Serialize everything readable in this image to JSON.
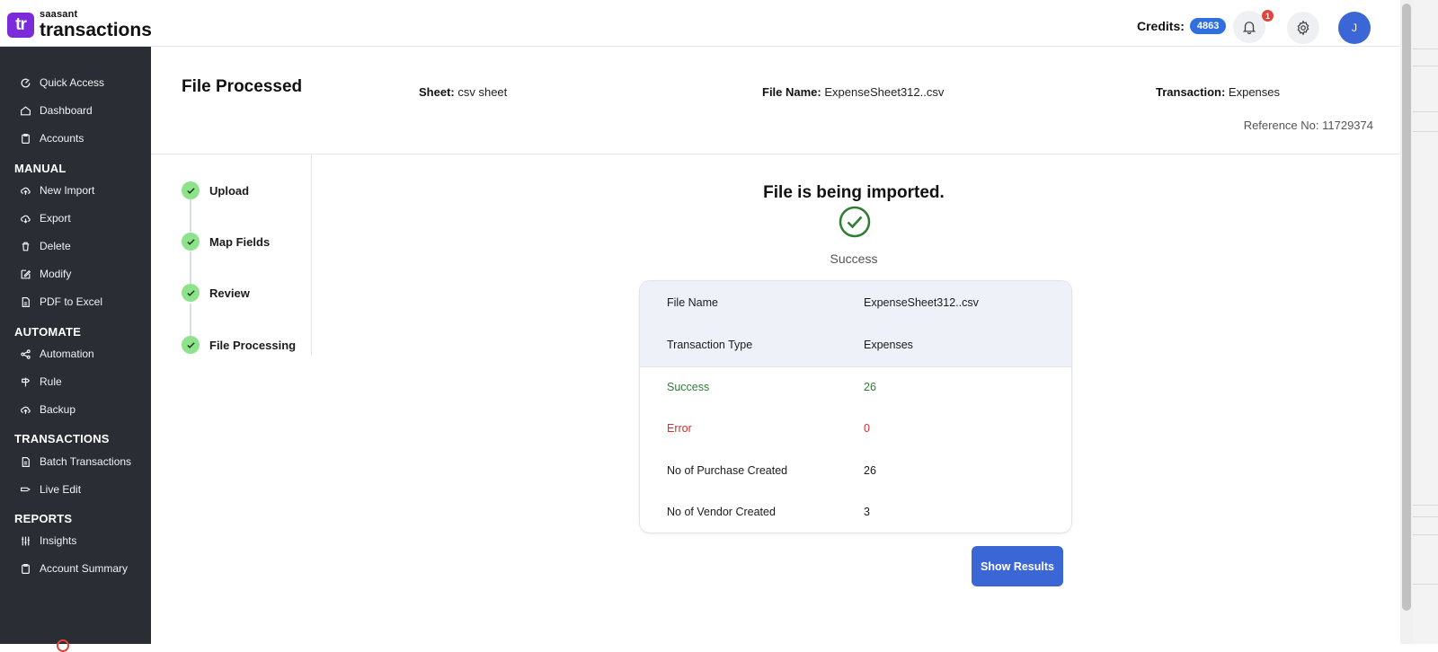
{
  "brand": {
    "small": "saasant",
    "big": "transactions",
    "badge": "tr",
    "color": "#7b2bd9"
  },
  "header": {
    "credits_label": "Credits:",
    "credits_value": "4863",
    "notification_count": "1",
    "avatar_initial": "J"
  },
  "sidebar": {
    "items_top": [
      {
        "label": "Quick Access",
        "icon": "quick-access-icon"
      },
      {
        "label": "Dashboard",
        "icon": "home-icon"
      },
      {
        "label": "Accounts",
        "icon": "clipboard-icon"
      }
    ],
    "sections": [
      {
        "title": "MANUAL",
        "items": [
          {
            "label": "New Import",
            "icon": "upload-cloud-icon"
          },
          {
            "label": "Export",
            "icon": "download-cloud-icon"
          },
          {
            "label": "Delete",
            "icon": "trash-icon"
          },
          {
            "label": "Modify",
            "icon": "edit-icon"
          },
          {
            "label": "PDF to Excel",
            "icon": "pdf-icon"
          }
        ]
      },
      {
        "title": "AUTOMATE",
        "items": [
          {
            "label": "Automation",
            "icon": "share-icon"
          },
          {
            "label": "Rule",
            "icon": "signpost-icon"
          },
          {
            "label": "Backup",
            "icon": "backup-icon"
          }
        ]
      },
      {
        "title": "TRANSACTIONS",
        "items": [
          {
            "label": "Batch Transactions",
            "icon": "document-icon"
          },
          {
            "label": "Live Edit",
            "icon": "pen-icon"
          }
        ]
      },
      {
        "title": "REPORTS",
        "items": [
          {
            "label": "Insights",
            "icon": "sliders-icon"
          },
          {
            "label": "Account Summary",
            "icon": "clipboard-icon"
          }
        ]
      }
    ]
  },
  "page": {
    "title": "File Processed",
    "sheet_label": "Sheet:",
    "sheet_value": "csv sheet",
    "file_label": "File Name:",
    "file_value": "ExpenseSheet312..csv",
    "transaction_label": "Transaction:",
    "transaction_value": "Expenses",
    "reference": "Reference No: 11729374"
  },
  "steps": [
    "Upload",
    "Map Fields",
    "Review",
    "File Processing"
  ],
  "status": {
    "title": "File is being imported.",
    "text": "Success",
    "success_color": "#2e7d32",
    "error_color": "#d32f2f"
  },
  "summary": {
    "rows": [
      {
        "key": "File Name",
        "value": "ExpenseSheet312..csv"
      },
      {
        "key": "Transaction Type",
        "value": "Expenses"
      },
      {
        "key": "Success",
        "value": "26"
      },
      {
        "key": "Error",
        "value": "0"
      },
      {
        "key": "No of Purchase Created",
        "value": "26"
      },
      {
        "key": "No of Vendor Created",
        "value": "3"
      }
    ]
  },
  "actions": {
    "show_results": "Show Results"
  },
  "accent_color": "#3a66d6"
}
